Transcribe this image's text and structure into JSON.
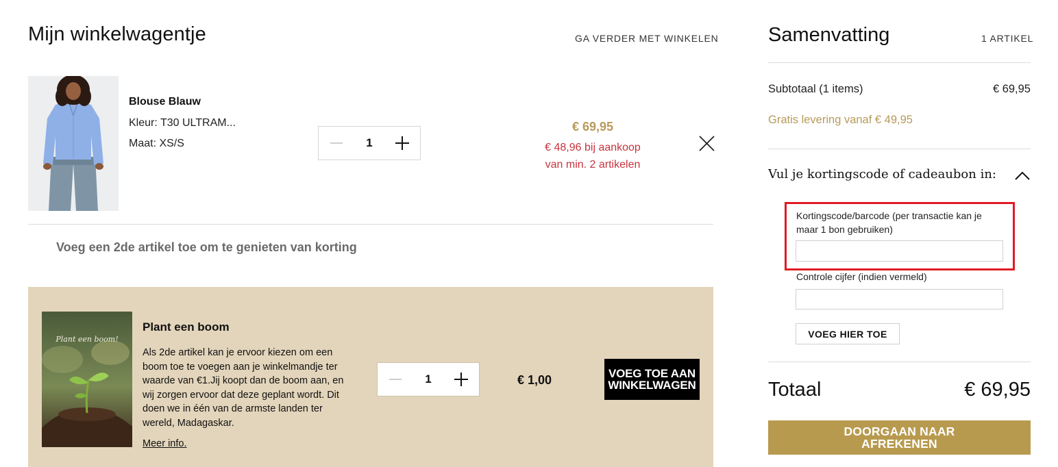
{
  "header": {
    "title": "Mijn winkelwagentje",
    "continue_link": "GA VERDER MET WINKELEN"
  },
  "cart_item": {
    "name": "Blouse Blauw",
    "color": "Kleur: T30 ULTRAM...",
    "size": "Maat: XS/S",
    "quantity": "1",
    "price": "€ 69,95",
    "promo_line1": "€ 48,96 bij aankoop",
    "promo_line2": "van min. 2 artikelen"
  },
  "promo_message": "Voeg een 2de artikel toe om te genieten van korting",
  "tree_offer": {
    "title": "Plant een boom",
    "image_caption": "Plant een boom!",
    "description": "Als 2de artikel kan je ervoor kiezen om een boom toe te voegen aan je winkelmandje ter waarde van €1.Jij koopt dan de boom aan, en wij zorgen ervoor dat deze geplant wordt. Dit doen we in één van de armste landen ter wereld, Madagaskar.",
    "more_info": "Meer info.",
    "quantity": "1",
    "price": "€ 1,00",
    "add_button_line1": "VOEG TOE AAN",
    "add_button_line2": "WINKELWAGEN"
  },
  "summary": {
    "title": "Samenvatting",
    "count": "1 ARTIKEL",
    "subtotal_label": "Subtotaal (1 items)",
    "subtotal_value": "€ 69,95",
    "free_delivery": "Gratis levering vanaf € 49,95",
    "coupon_toggle": "Vul je kortingscode of cadeaubon in:",
    "code_label": "Kortingscode/barcode (per transactie kan je maar 1 bon gebruiken)",
    "code_value": "",
    "check_label": "Controle cijfer (indien vermeld)",
    "check_value": "",
    "apply_button": "VOEG HIER TOE",
    "total_label": "Totaal",
    "total_value": "€ 69,95",
    "checkout_line1": "DOORGAAN NAAR",
    "checkout_line2": "AFREKENEN"
  },
  "colors": {
    "gold": "#b89a5a",
    "promo_red": "#c8323c",
    "banner_bg": "#e3d5bb",
    "checkout_bg": "#b89a4f",
    "highlight": "#e01b24"
  },
  "icons": {
    "minus": "minus-icon",
    "plus": "plus-icon",
    "close": "close-icon",
    "chevron": "chevron-up-icon"
  }
}
